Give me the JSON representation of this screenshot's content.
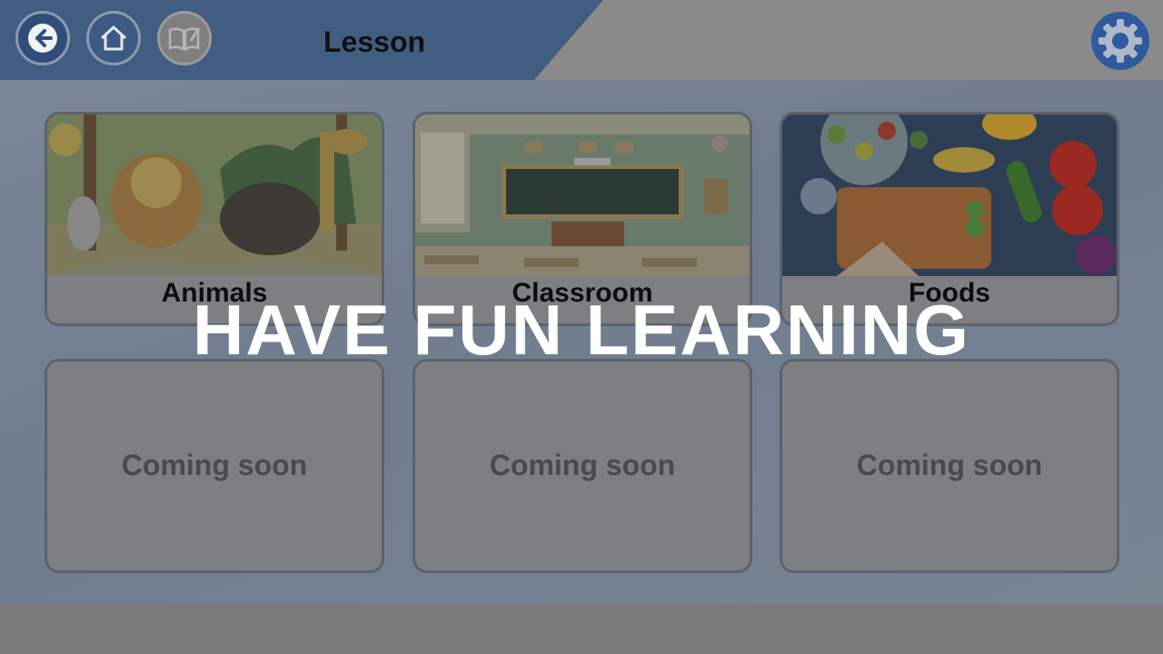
{
  "header": {
    "title": "Lesson",
    "icons": {
      "back": "arrow-left-icon",
      "home": "home-icon",
      "book": "book-edit-icon",
      "settings": "gear-icon"
    },
    "colors": {
      "band": "#425d82",
      "settings": "#2f5aa0"
    }
  },
  "lessons": [
    {
      "label": "Animals"
    },
    {
      "label": "Classroom"
    },
    {
      "label": "Foods"
    }
  ],
  "coming_soon": [
    {
      "label": "Coming soon"
    },
    {
      "label": "Coming soon"
    },
    {
      "label": "Coming soon"
    }
  ],
  "overlay": {
    "text": "HAVE FUN LEARNING"
  }
}
